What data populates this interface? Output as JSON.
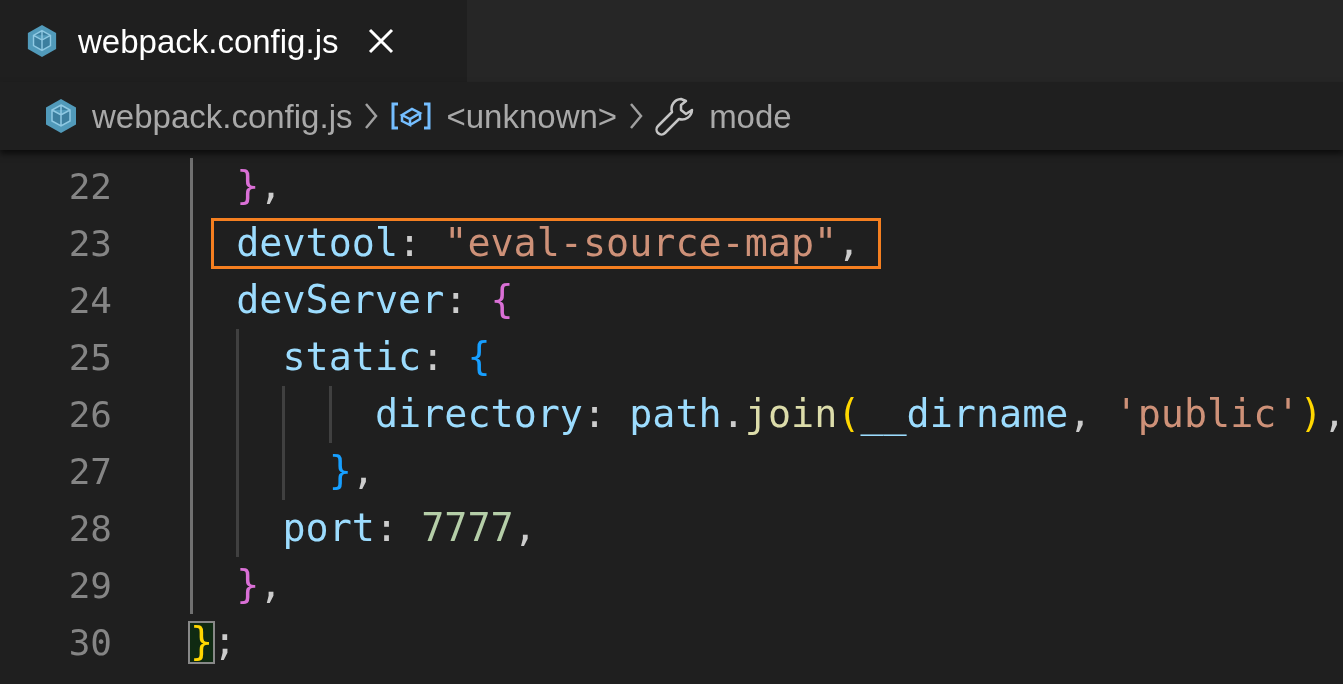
{
  "tabs": [
    {
      "label": "webpack.config.js",
      "selected": true
    }
  ],
  "breadcrumbs": [
    {
      "kind": "file",
      "label": "webpack.config.js"
    },
    {
      "kind": "object",
      "label": "<unknown>"
    },
    {
      "kind": "property",
      "label": "mode"
    }
  ],
  "lines": [
    {
      "number": "22",
      "highlighted": false,
      "tokens": [
        {
          "kind": "brace1",
          "text": "  }"
        },
        {
          "kind": "punct",
          "text": ","
        }
      ]
    },
    {
      "number": "23",
      "highlighted": true,
      "tokens": [
        {
          "kind": "key",
          "text": "  devtool"
        },
        {
          "kind": "punct",
          "text": ": "
        },
        {
          "kind": "string",
          "text": "\"eval-source-map\""
        },
        {
          "kind": "punct",
          "text": ","
        }
      ]
    },
    {
      "number": "24",
      "highlighted": false,
      "tokens": [
        {
          "kind": "key",
          "text": "  devServer"
        },
        {
          "kind": "punct",
          "text": ": "
        },
        {
          "kind": "brace1",
          "text": "{"
        }
      ]
    },
    {
      "number": "25",
      "highlighted": false,
      "tokens": [
        {
          "kind": "key",
          "text": "    static"
        },
        {
          "kind": "punct",
          "text": ": "
        },
        {
          "kind": "brace2",
          "text": "{"
        }
      ]
    },
    {
      "number": "26",
      "highlighted": false,
      "tokens": [
        {
          "kind": "key",
          "text": "        directory"
        },
        {
          "kind": "punct",
          "text": ": "
        },
        {
          "kind": "ident",
          "text": "path"
        },
        {
          "kind": "punct",
          "text": "."
        },
        {
          "kind": "func",
          "text": "join"
        },
        {
          "kind": "brace0",
          "text": "("
        },
        {
          "kind": "ident",
          "text": "__dirname"
        },
        {
          "kind": "punct",
          "text": ", "
        },
        {
          "kind": "string",
          "text": "'public'"
        },
        {
          "kind": "brace0",
          "text": ")"
        },
        {
          "kind": "punct",
          "text": ","
        }
      ]
    },
    {
      "number": "27",
      "highlighted": false,
      "tokens": [
        {
          "kind": "brace2",
          "text": "      }"
        },
        {
          "kind": "punct",
          "text": ","
        }
      ]
    },
    {
      "number": "28",
      "highlighted": false,
      "tokens": [
        {
          "kind": "key",
          "text": "    port"
        },
        {
          "kind": "punct",
          "text": ": "
        },
        {
          "kind": "number",
          "text": "7777"
        },
        {
          "kind": "punct",
          "text": ","
        }
      ]
    },
    {
      "number": "29",
      "highlighted": false,
      "tokens": [
        {
          "kind": "brace1",
          "text": "  }"
        },
        {
          "kind": "punct",
          "text": ","
        }
      ]
    },
    {
      "number": "30",
      "highlighted": false,
      "tokens": [
        {
          "kind": "brace0",
          "text": "}",
          "matched": true
        },
        {
          "kind": "punct",
          "text": ";"
        }
      ]
    }
  ]
}
